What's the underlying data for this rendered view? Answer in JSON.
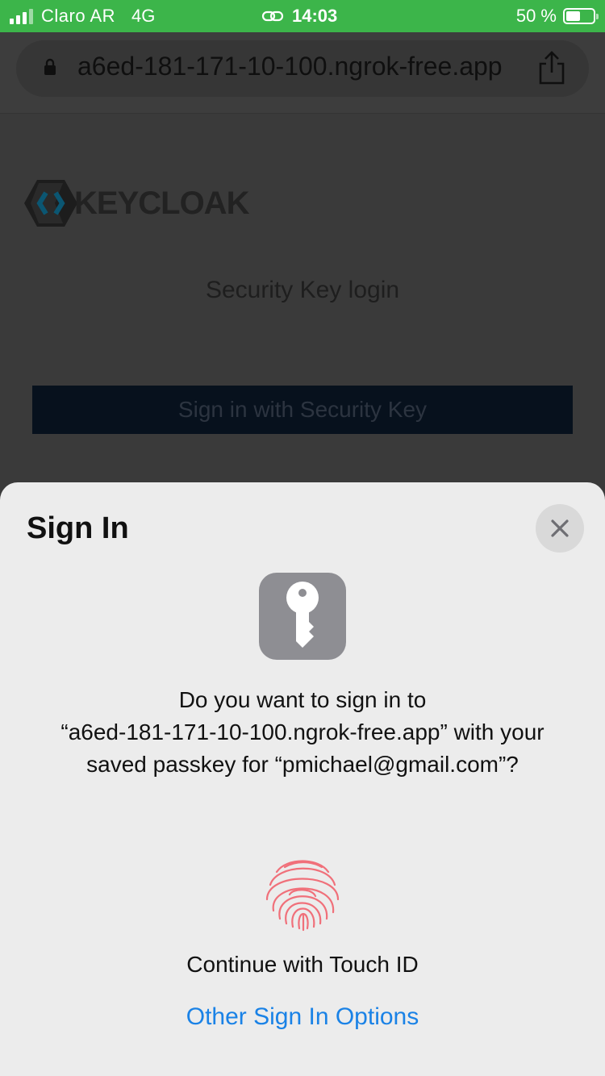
{
  "status_bar": {
    "carrier": "Claro AR",
    "network": "4G",
    "time": "14:03",
    "battery": "50 %",
    "battery_level": 0.5,
    "signal_bars": 4,
    "signal_bars_filled": 3
  },
  "browser": {
    "url": "a6ed-181-171-10-100.ngrok-free.app"
  },
  "page": {
    "logo_text": "KEYCLOAK",
    "title": "Security Key login",
    "button_label": "Sign in with Security Key"
  },
  "sheet": {
    "title": "Sign In",
    "prompt_lines": [
      "Do you want to sign in to",
      "“a6ed-181-171-10-100.ngrok-free.app” with your",
      "saved passkey for “pmichael@gmail.com”?"
    ],
    "touch_label": "Continue with Touch ID",
    "other_options": "Other Sign In Options"
  },
  "colors": {
    "status_bar": "#3cb54a",
    "link": "#1a82e6",
    "fingerprint": "#f0707a",
    "key_tile": "#8e8e93"
  }
}
